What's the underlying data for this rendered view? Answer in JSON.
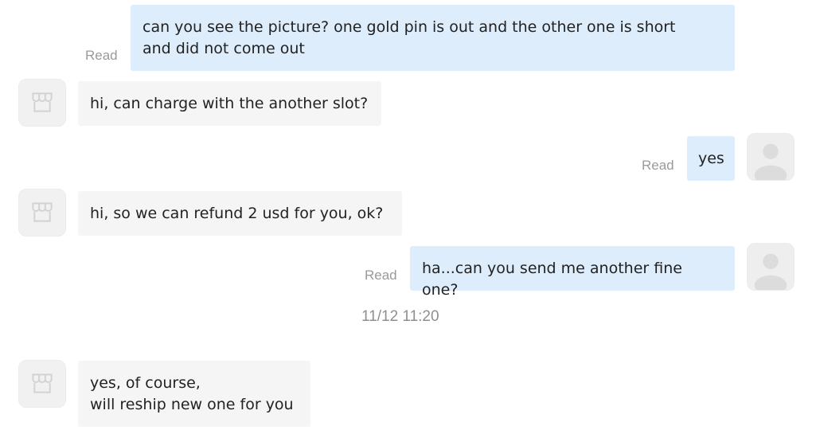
{
  "messages": [
    {
      "sender": "customer",
      "text": "can you see the picture? one gold pin is out and the other one is short\nand did not come out",
      "read_label": "Read"
    },
    {
      "sender": "seller",
      "text": "hi, can charge with the another slot?"
    },
    {
      "sender": "customer",
      "text": "yes",
      "read_label": "Read"
    },
    {
      "sender": "seller",
      "text": "hi, so we can refund 2 usd for you, ok?"
    },
    {
      "sender": "customer",
      "text": "ha...can you send me another fine one?",
      "read_label": "Read"
    },
    {
      "sender": "seller",
      "text": "yes, of course,\nwill reship new one for you"
    }
  ],
  "timestamp": "11/12 11:20",
  "icons": {
    "seller_avatar": "store-icon",
    "customer_avatar": "user-icon"
  },
  "colors": {
    "outgoing_bubble": "#deedfc",
    "incoming_bubble": "#f5f5f5",
    "read_text": "#9a9a9a",
    "avatar_bg": "#f1f1f1"
  }
}
